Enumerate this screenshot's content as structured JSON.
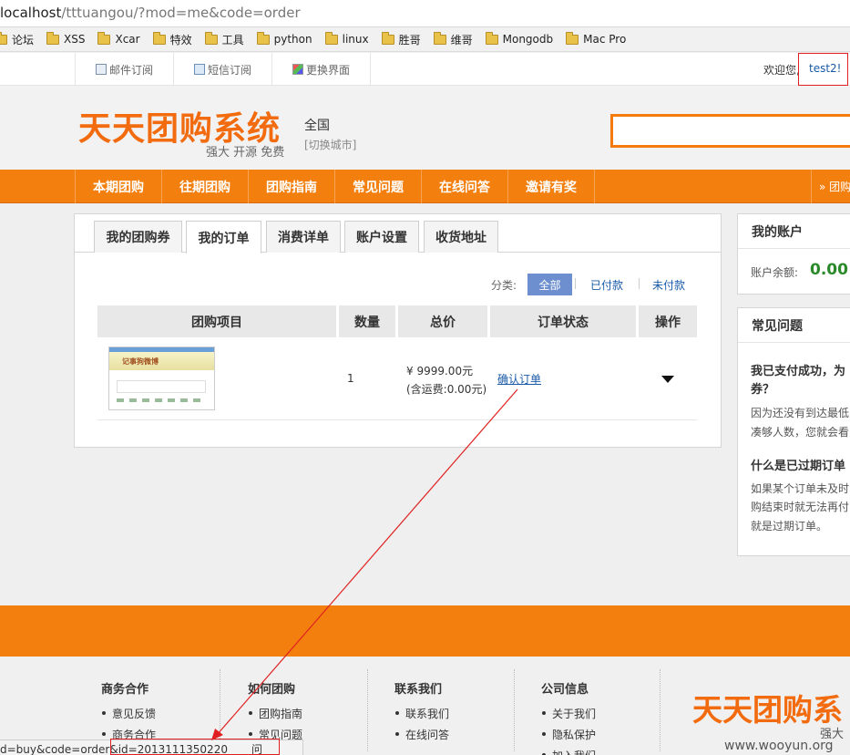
{
  "browser": {
    "url_host": "localhost",
    "url_path": "/tttuangou/?mod=me&code=order",
    "bookmarks": [
      "论坛",
      "XSS",
      "Xcar",
      "特效",
      "工具",
      "python",
      "linux",
      "胜哥",
      "维哥",
      "Mongodb",
      "Mac Pro"
    ],
    "status_prefix": "d=buy&code=order&",
    "status_highlight": "id=2013111350220",
    "status_tail": "问"
  },
  "topbar": {
    "links": [
      "邮件订阅",
      "短信订阅",
      "更换界面"
    ],
    "welcome": "欢迎您,",
    "username": "test2!"
  },
  "header": {
    "logo": "天天团购系统",
    "slogan": "强大 开源 免费",
    "city": "全国",
    "change_city": "[切换城市]"
  },
  "nav": {
    "items": [
      "本期团购",
      "往期团购",
      "团购指南",
      "常见问题",
      "在线问答",
      "邀请有奖"
    ],
    "right": "» 团购"
  },
  "tabs": [
    "我的团购券",
    "我的订单",
    "消费详单",
    "账户设置",
    "收货地址"
  ],
  "filter": {
    "label": "分类:",
    "all": "全部",
    "paid": "已付款",
    "unpaid": "未付款"
  },
  "table": {
    "headers": [
      "团购项目",
      "数量",
      "总价",
      "订单状态",
      "操作"
    ],
    "row": {
      "thumb_title": "记事狗微博",
      "quantity": "1",
      "price": "¥ 9999.00元",
      "shipping": "(含运费:0.00元)",
      "status": "确认订单"
    }
  },
  "sidebar": {
    "account_title": "我的账户",
    "balance_label": "账户余额:",
    "balance": "0.00",
    "faq_title": "常见问题",
    "q1_line1": "我已支付成功，为",
    "q1_line2": "券？",
    "a1_line1": "因为还没有到达最低",
    "a1_line2": "凑够人数，您就会看",
    "q2": "什么是已过期订单",
    "a2_line1": "如果某个订单未及时",
    "a2_line2": "购结束时就无法再付",
    "a2_line3": "就是过期订单。"
  },
  "footer": {
    "cols": [
      {
        "title": "商务合作",
        "items": [
          "意见反馈",
          "商务合作"
        ]
      },
      {
        "title": "如何团购",
        "items": [
          "团购指南",
          "常见问题"
        ]
      },
      {
        "title": "联系我们",
        "items": [
          "联系我们",
          "在线问答"
        ]
      },
      {
        "title": "公司信息",
        "items": [
          "关于我们",
          "隐私保护",
          "加入我们"
        ]
      }
    ],
    "logo": "天天团购系",
    "slogan": "强大",
    "watermark": "www.wooyun.org"
  },
  "colors": {
    "brand_orange": "#f37f0e",
    "annotation_red": "#e02020",
    "link_blue": "#1a5aa8",
    "balance_green": "#2a8a2a"
  }
}
